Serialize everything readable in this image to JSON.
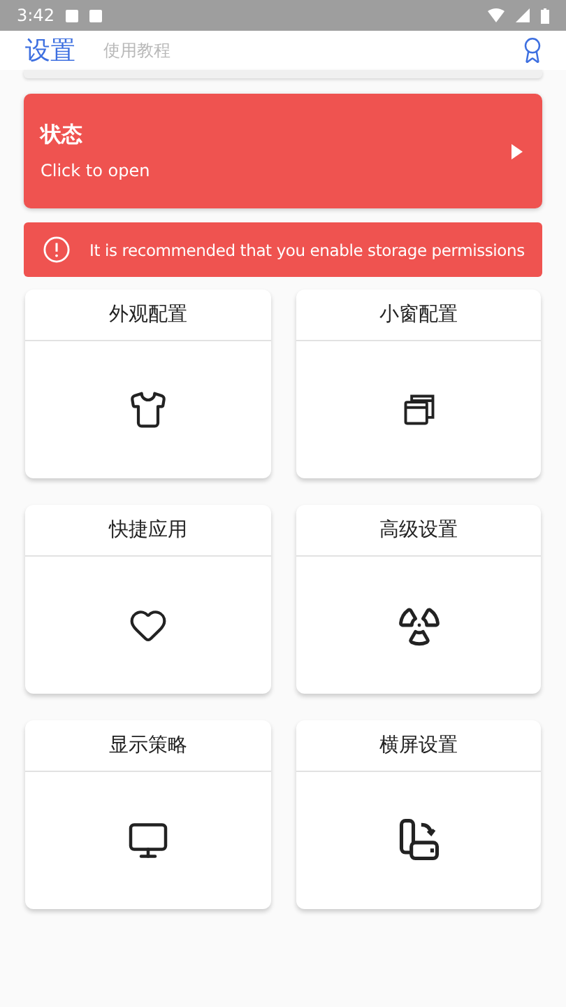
{
  "status_bar": {
    "time": "3:42"
  },
  "header": {
    "title": "设置",
    "subtitle": "使用教程"
  },
  "status_card": {
    "title": "状态",
    "subtitle": "Click to open"
  },
  "warning": {
    "text": "It is recommended that you enable storage permissions"
  },
  "tiles": [
    {
      "label": "外观配置"
    },
    {
      "label": "小窗配置"
    },
    {
      "label": "快捷应用"
    },
    {
      "label": "高级设置"
    },
    {
      "label": "显示策略"
    },
    {
      "label": "横屏设置"
    }
  ]
}
